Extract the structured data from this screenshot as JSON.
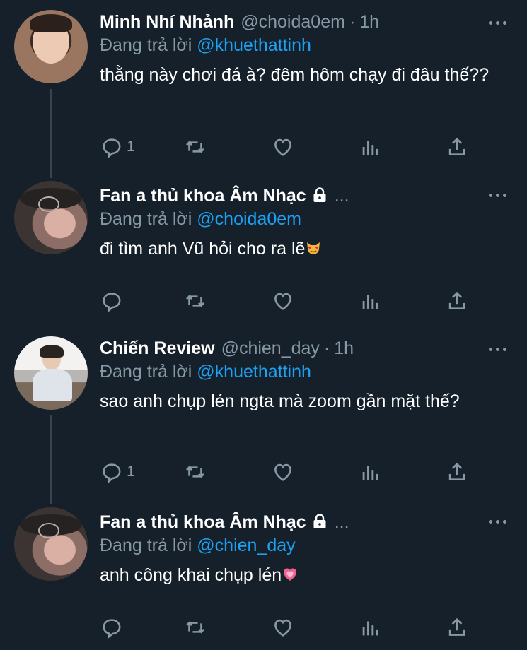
{
  "colors": {
    "background": "#15202b",
    "accent": "#1da1f2",
    "muted": "#8899a6",
    "divider": "#38444d"
  },
  "tweets": [
    {
      "name": "Minh Nhí Nhảnh",
      "handle": "@choida0em",
      "dot": "·",
      "time": "1h",
      "reply_prefix": "Đang trả lời",
      "reply_to": "@khuethattinh",
      "text": "thằng này chơi đá à? đêm hôm chạy đi đâu thế??",
      "reply_count": "1"
    },
    {
      "name": "Fan a thủ khoa Âm Nhạc",
      "protected": true,
      "truncation": "...",
      "reply_prefix": "Đang trả lời",
      "reply_to": "@choida0em",
      "text": "đi tìm anh Vũ hỏi cho ra lẽ",
      "emoji": "heart-eyes-cat-emoji",
      "reply_count": ""
    },
    {
      "name": "Chiến Review",
      "handle": "@chien_day",
      "dot": "·",
      "time": "1h",
      "reply_prefix": "Đang trả lời",
      "reply_to": "@khuethattinh",
      "text": "sao anh chụp lén ngta mà zoom gần mặt thế?",
      "reply_count": "1"
    },
    {
      "name": "Fan a thủ khoa Âm Nhạc",
      "protected": true,
      "truncation": "...",
      "reply_prefix": "Đang trả lời",
      "reply_to": "@chien_day",
      "text": "anh công khai chụp lén",
      "emoji": "growing-heart-emoji",
      "reply_count": ""
    }
  ],
  "icons": {
    "reply": "reply-bubble-icon",
    "retweet": "retweet-icon",
    "like": "heart-icon",
    "analytics": "analytics-bars-icon",
    "share": "share-upload-icon",
    "more": "more-dots-icon",
    "lock": "lock-icon"
  }
}
